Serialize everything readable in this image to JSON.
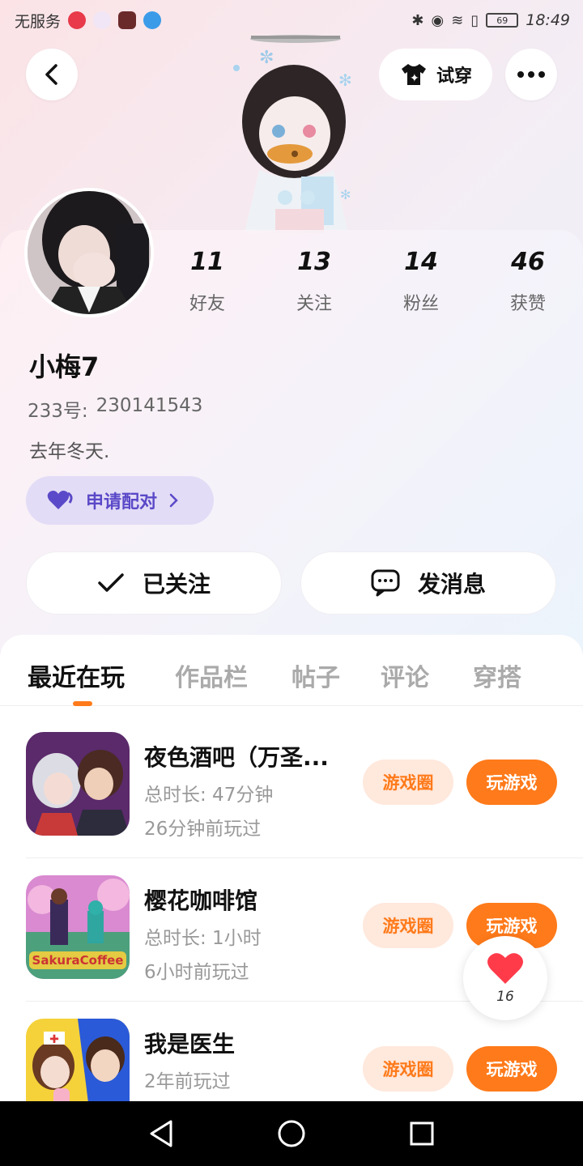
{
  "status_bar": {
    "carrier": "无服务",
    "time": "18:49",
    "battery": "69"
  },
  "header": {
    "tryon_label": "试穿"
  },
  "profile": {
    "stats": [
      {
        "value": "11",
        "label": "好友"
      },
      {
        "value": "13",
        "label": "关注"
      },
      {
        "value": "14",
        "label": "粉丝"
      },
      {
        "value": "46",
        "label": "获赞"
      }
    ],
    "nickname": "小梅7",
    "id_label": "233号:",
    "id_value": "230141543",
    "bio": "去年冬天.",
    "pair_label": "申请配对",
    "follow_label": "已关注",
    "message_label": "发消息"
  },
  "tabs": [
    {
      "label": "最近在玩",
      "active": true
    },
    {
      "label": "作品栏",
      "active": false
    },
    {
      "label": "帖子",
      "active": false
    },
    {
      "label": "评论",
      "active": false
    },
    {
      "label": "穿搭",
      "active": false
    }
  ],
  "games": [
    {
      "title": "夜色酒吧（万圣...",
      "duration": "总时长: 47分钟",
      "last_played": "26分钟前玩过",
      "circle_label": "游戏圈",
      "play_label": "玩游戏"
    },
    {
      "title": "樱花咖啡馆",
      "duration": "总时长: 1小时",
      "last_played": "6小时前玩过",
      "circle_label": "游戏圈",
      "play_label": "玩游戏",
      "icon_text": "SakuraCoffee"
    },
    {
      "title": "我是医生",
      "duration": "",
      "last_played": "2年前玩过",
      "circle_label": "游戏圈",
      "play_label": "玩游戏"
    }
  ],
  "like_float": {
    "count": "16"
  },
  "colors": {
    "accent": "#ff7a1a",
    "pair_bg": "#e3dcf6",
    "pair_text": "#5a49c8"
  }
}
